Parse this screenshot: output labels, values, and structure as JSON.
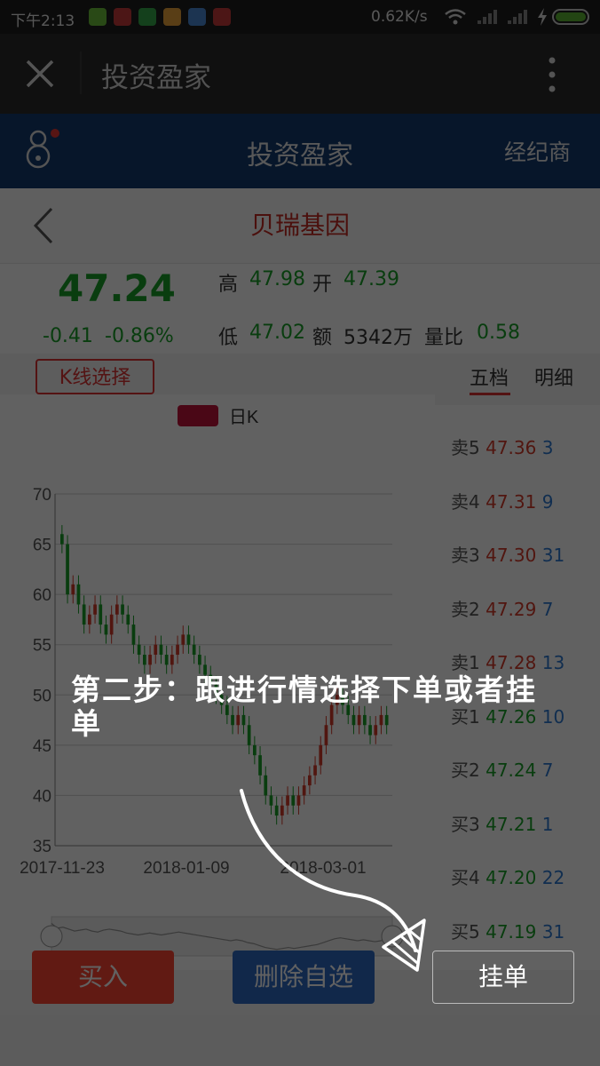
{
  "status_bar": {
    "time": "下午2:13",
    "speed": "0.62K/s"
  },
  "title_bar": {
    "title": "投资盈家"
  },
  "header": {
    "title": "投资盈家",
    "right_label": "经纪商"
  },
  "stock": {
    "name": "贝瑞基因",
    "price": "47.24",
    "change": "-0.41",
    "change_pct": "-0.86%",
    "high_label": "高",
    "high": "47.98",
    "open_label": "开",
    "open": "47.39",
    "low_label": "低",
    "low": "47.02",
    "amount_label": "额",
    "amount": "5342万",
    "ratio_label": "量比",
    "ratio": "0.58"
  },
  "kline_button": "K线选择",
  "tabs": [
    "五档",
    "明细"
  ],
  "colors": {
    "up": "#d63b2a",
    "down": "#18a028",
    "header": "#143a70",
    "buy_button": "#ff4433",
    "remove_button": "#2e6bc2"
  },
  "chart_data": {
    "type": "candlestick",
    "legend": "日K",
    "ylim": [
      35,
      70
    ],
    "yticks": [
      35,
      40,
      45,
      50,
      55,
      60,
      65,
      70
    ],
    "xticks": [
      "2017-11-23",
      "2018-01-09",
      "2018-03-01"
    ],
    "closes": [
      65,
      60,
      61,
      59,
      57,
      58,
      59,
      57,
      56,
      58,
      59,
      58,
      57,
      55,
      54,
      53,
      54,
      55,
      54,
      53,
      54,
      55,
      56,
      55,
      54,
      53,
      52,
      51,
      50,
      49,
      48,
      47,
      48,
      47,
      45,
      44,
      42,
      40,
      39,
      38,
      39,
      40,
      39,
      40,
      41,
      42,
      43,
      45,
      47,
      49,
      50,
      49,
      48,
      47,
      48,
      47,
      46,
      47,
      48,
      47
    ]
  },
  "order_book": {
    "sell": [
      {
        "label": "卖5",
        "price": "47.36",
        "vol": "3"
      },
      {
        "label": "卖4",
        "price": "47.31",
        "vol": "9"
      },
      {
        "label": "卖3",
        "price": "47.30",
        "vol": "31"
      },
      {
        "label": "卖2",
        "price": "47.29",
        "vol": "7"
      },
      {
        "label": "卖1",
        "price": "47.28",
        "vol": "13"
      }
    ],
    "buy": [
      {
        "label": "买1",
        "price": "47.26",
        "vol": "10"
      },
      {
        "label": "买2",
        "price": "47.24",
        "vol": "7"
      },
      {
        "label": "买3",
        "price": "47.21",
        "vol": "1"
      },
      {
        "label": "买4",
        "price": "47.20",
        "vol": "22"
      },
      {
        "label": "买5",
        "price": "47.19",
        "vol": "31"
      }
    ]
  },
  "buttons": {
    "buy": "买入",
    "remove": "删除自选",
    "limit_order": "挂单"
  },
  "guide_text": "第二步：跟进行情选择下单或者挂单"
}
